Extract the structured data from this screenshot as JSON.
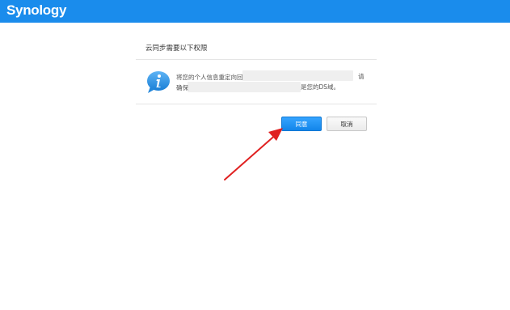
{
  "header": {
    "brand": "Synology",
    "bar_color": "#1a8cec"
  },
  "dialog": {
    "title": "云同步需要以下权限",
    "icon": "info-speech-bubble-icon",
    "message_line1": "将您的个人信息重定向回",
    "message_line1_tail": "请",
    "message_line2": "确保",
    "message_line2_tail": "是您的DS域。"
  },
  "buttons": {
    "agree_label": "同意",
    "cancel_label": "取消"
  },
  "annotation": {
    "arrow_color": "#e02020"
  }
}
